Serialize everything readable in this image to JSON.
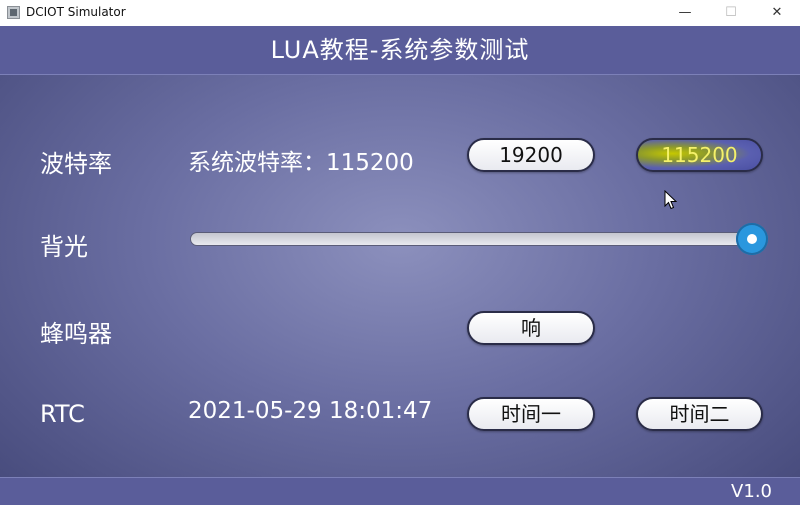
{
  "window": {
    "title": "DCIOT Simulator",
    "controls": {
      "minimize": "—",
      "maximize": "☐",
      "close": "✕"
    }
  },
  "header": {
    "title": "LUA教程-系统参数测试"
  },
  "baud": {
    "label": "波特率",
    "status": "系统波特率：115200",
    "option_1": "19200",
    "option_2": "115200",
    "selected": "115200"
  },
  "backlight": {
    "label": "背光",
    "level_fraction": 1.0
  },
  "buzzer": {
    "label": "蜂鸣器",
    "button": "响"
  },
  "rtc": {
    "label": "RTC",
    "datetime": "2021-05-29 18:01:47",
    "button_1": "时间一",
    "button_2": "时间二"
  },
  "footer": {
    "version": "V1.0"
  },
  "colors": {
    "header_bar": "#5a5d9a",
    "background": "#6a6ea2",
    "slider_knob": "#2a97de",
    "active_button_highlight": "#c6c800"
  }
}
